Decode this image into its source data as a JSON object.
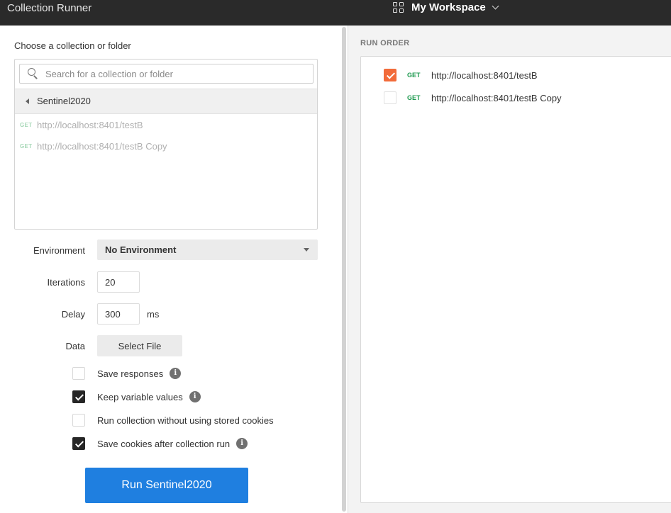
{
  "app": {
    "title": "Collection Runner",
    "workspace": "My Workspace"
  },
  "left": {
    "choose_label": "Choose a collection or folder",
    "search_placeholder": "Search for a collection or folder",
    "folder": "Sentinel2020",
    "requests": [
      {
        "method": "GET",
        "url": "http://localhost:8401/testB"
      },
      {
        "method": "GET",
        "url": "http://localhost:8401/testB Copy"
      }
    ],
    "environment": {
      "label": "Environment",
      "value": "No Environment"
    },
    "iterations": {
      "label": "Iterations",
      "value": "20"
    },
    "delay": {
      "label": "Delay",
      "value": "300",
      "unit": "ms"
    },
    "data": {
      "label": "Data",
      "button": "Select File"
    },
    "options": [
      {
        "label": "Save responses",
        "checked": false,
        "info": true
      },
      {
        "label": "Keep variable values",
        "checked": true,
        "info": true
      },
      {
        "label": "Run collection without using stored cookies",
        "checked": false,
        "info": false
      },
      {
        "label": "Save cookies after collection run",
        "checked": true,
        "info": true
      }
    ],
    "run_button": "Run Sentinel2020"
  },
  "right": {
    "title": "RUN ORDER",
    "items": [
      {
        "method": "GET",
        "url": "http://localhost:8401/testB",
        "checked": true
      },
      {
        "method": "GET",
        "url": "http://localhost:8401/testB Copy",
        "checked": false
      }
    ]
  },
  "colors": {
    "primary": "#1f7fe0",
    "accent": "#f26b3a",
    "get_method": "#1e9a4f",
    "topbar": "#2a2a2a"
  }
}
